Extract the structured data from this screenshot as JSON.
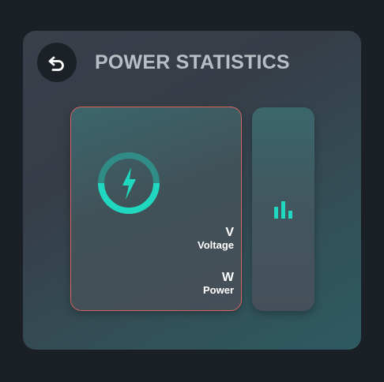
{
  "header": {
    "title": "POWER STATISTICS",
    "back_icon": "back-arrow-icon"
  },
  "main_card": {
    "icon": "lightning-bolt-icon",
    "accent_color": "#1fd8bf",
    "voltage": {
      "unit": "V",
      "label": "Voltage"
    },
    "power": {
      "unit": "W",
      "label": "Power"
    }
  },
  "side_card": {
    "icon": "bar-chart-icon",
    "accent_color": "#1fd8bf"
  },
  "colors": {
    "background": "#1b1f26",
    "card_border": "#d4655e",
    "title_text": "#b9bec5"
  }
}
